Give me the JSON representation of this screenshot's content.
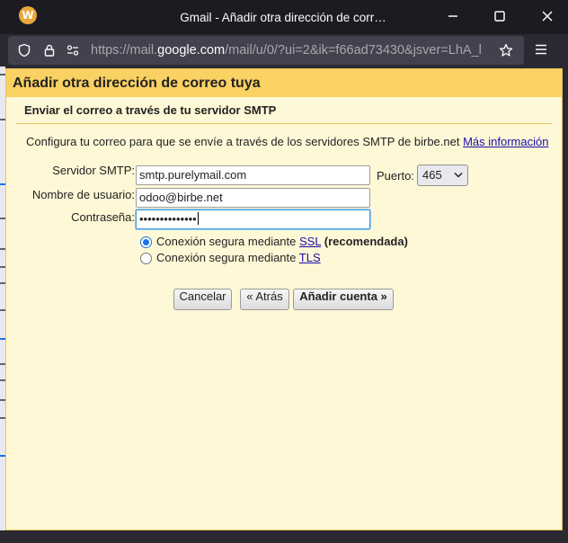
{
  "window": {
    "title": "Gmail - Añadir otra dirección de corr…",
    "logo_letter": "W"
  },
  "urlbar": {
    "url_prefix": "https://mail.",
    "url_domain": "google.com",
    "url_suffix": "/mail/u/0/?ui=2&ik=f66ad73430&jsver=LhA_l"
  },
  "dialog": {
    "header": "Añadir otra dirección de correo tuya",
    "section_title": "Enviar el correo a través de tu servidor SMTP",
    "description": "Configura tu correo para que se envíe a través de los servidores SMTP de birbe.net",
    "more_info_link": "Más información",
    "smtp_label": "Servidor SMTP:",
    "smtp_value": "smtp.purelymail.com",
    "port_label": "Puerto:",
    "port_value": "465",
    "username_label": "Nombre de usuario:",
    "username_value": "odoo@birbe.net",
    "password_label": "Contraseña:",
    "password_value": "••••••••••••••",
    "ssl_option_prefix": "Conexión segura mediante",
    "ssl_link": "SSL",
    "ssl_recommended": "(recomendada)",
    "tls_option_prefix": "Conexión segura mediante",
    "tls_link": "TLS",
    "cancel_button": "Cancelar",
    "back_button": "« Atrás",
    "add_account_button": "Añadir cuenta »"
  },
  "colors": {
    "header_bg": "#fad163",
    "dialog_bg": "#fff8d7",
    "link": "#1a0dab",
    "radio_selected": "#1a73e8"
  }
}
